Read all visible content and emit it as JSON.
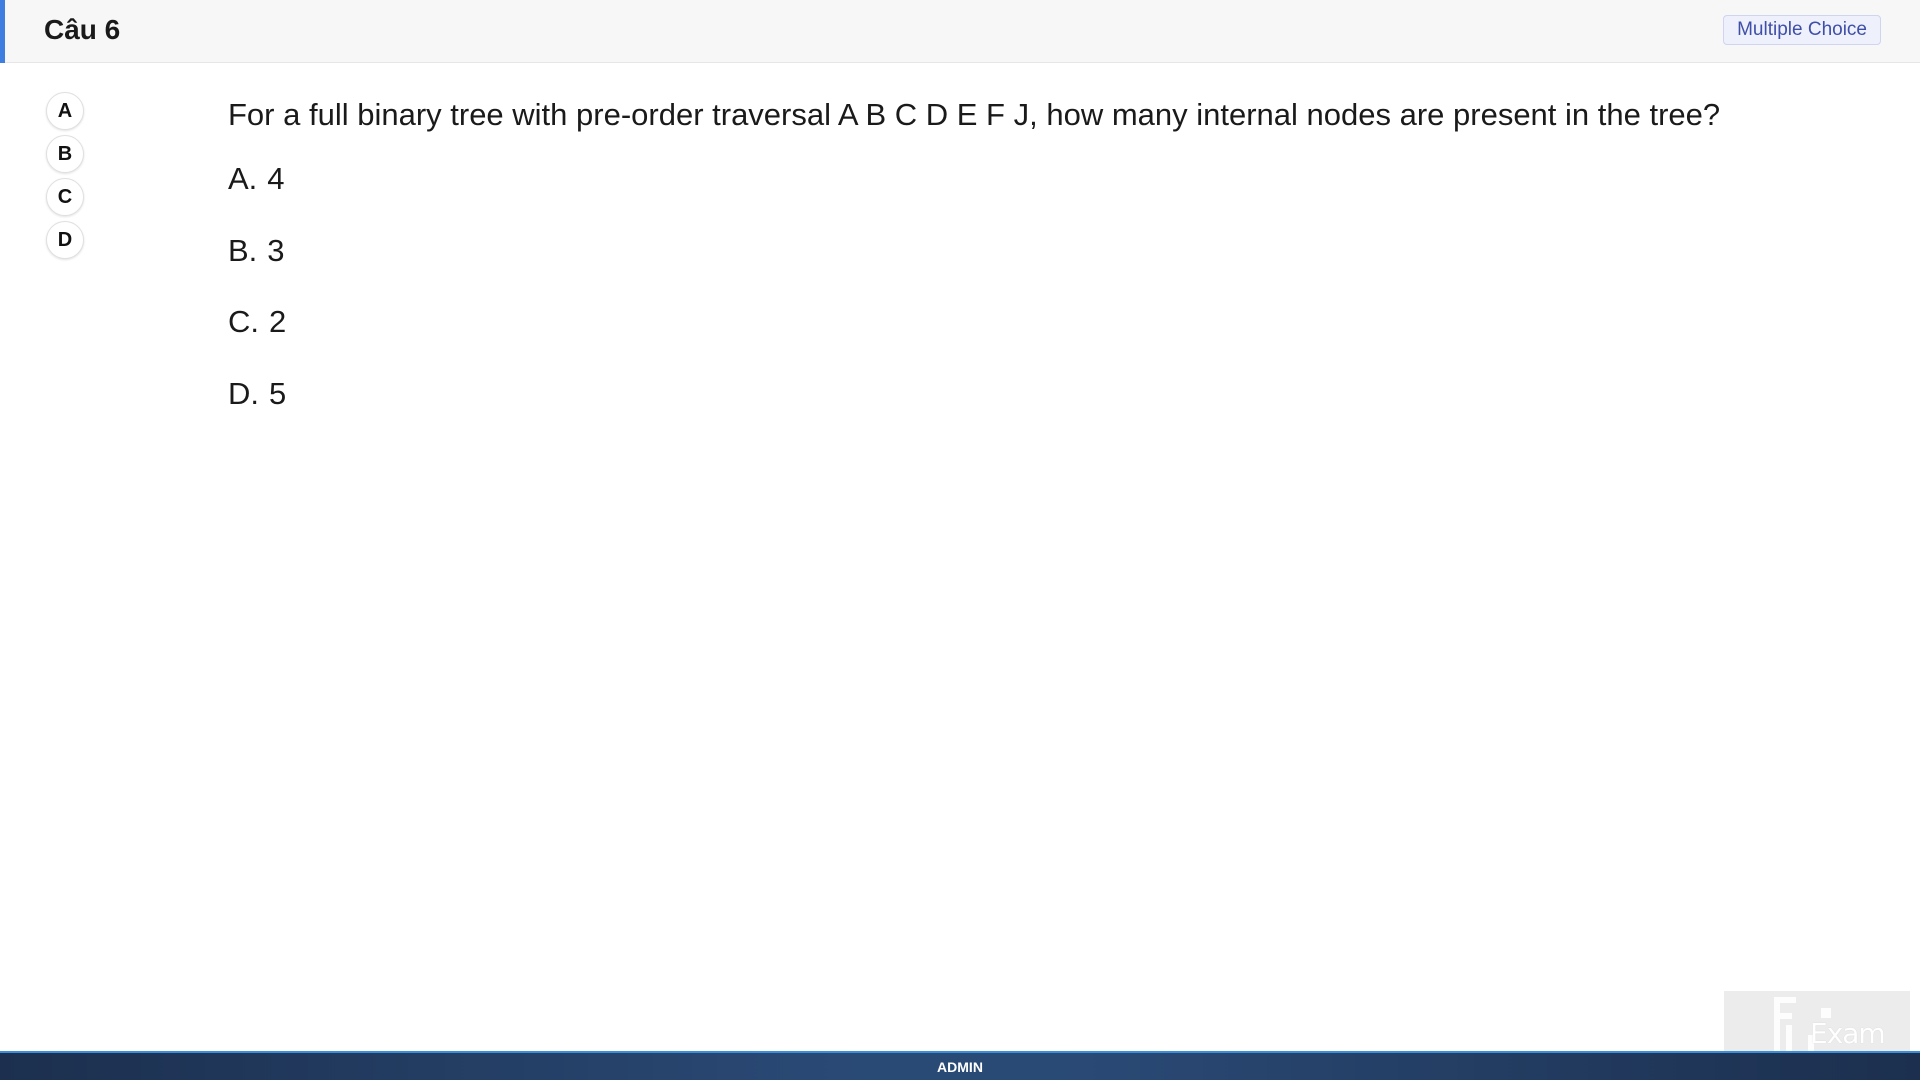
{
  "header": {
    "question_title": "Câu 6",
    "question_type": "Multiple Choice",
    "accent_color": "#3d7ee0"
  },
  "answer_selector": {
    "letters": [
      "A",
      "B",
      "C",
      "D"
    ]
  },
  "question": {
    "text": "For a full binary tree with pre-order traversal A B C D E F J, how many internal nodes are present in the tree?",
    "options": [
      {
        "letter": "A.",
        "value": "4"
      },
      {
        "letter": "B.",
        "value": "3"
      },
      {
        "letter": "C.",
        "value": "2"
      },
      {
        "letter": "D.",
        "value": "5"
      }
    ]
  },
  "footer": {
    "user_label": "ADMIN",
    "bar_color": "#2a4a76",
    "border_color": "#3a8fd8"
  },
  "watermark": {
    "text": "Exam",
    "icon": "fu-logo-icon"
  }
}
